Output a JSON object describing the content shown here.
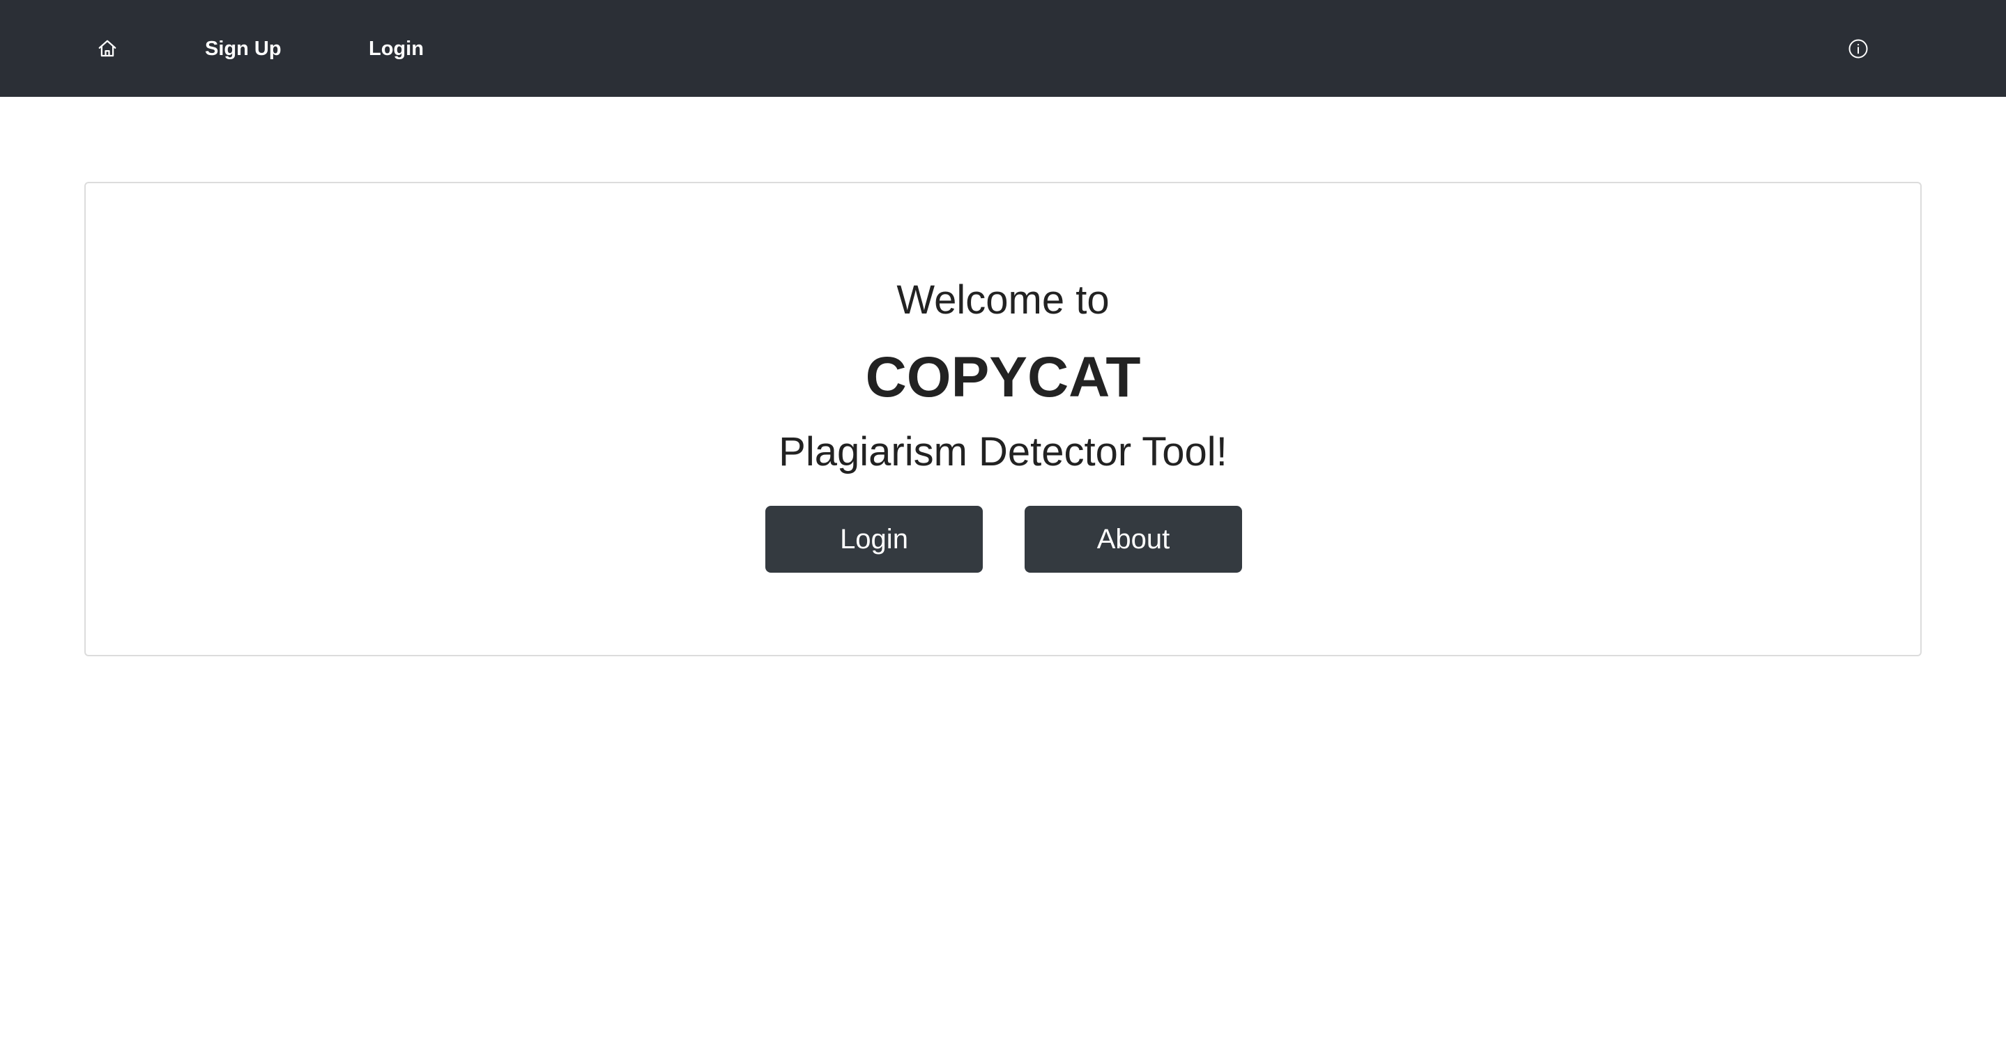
{
  "navbar": {
    "home_icon": "home-icon",
    "links": [
      {
        "label": "Sign Up"
      },
      {
        "label": "Login"
      }
    ],
    "info_icon": "info-icon",
    "background": "#2b2f36"
  },
  "hero": {
    "welcome": "Welcome to",
    "brand": "COPYCAT",
    "tagline": "Plagiarism Detector Tool!",
    "buttons": [
      {
        "label": "Login"
      },
      {
        "label": "About"
      }
    ],
    "button_color": "#343a40"
  }
}
